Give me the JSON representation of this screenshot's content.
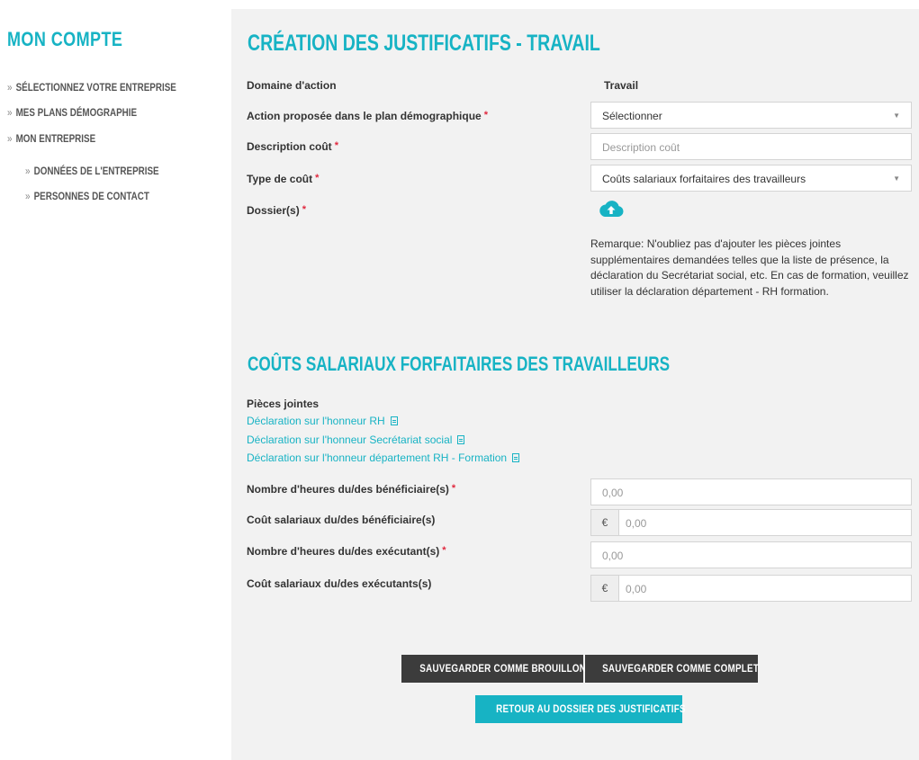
{
  "sidebar": {
    "title": "MON COMPTE",
    "items": [
      {
        "label": "SÉLECTIONNEZ VOTRE ENTREPRISE"
      },
      {
        "label": "MES PLANS DÉMOGRAPHIE"
      },
      {
        "label": "MON ENTREPRISE"
      },
      {
        "label": "DONNÉES DE L'ENTREPRISE"
      },
      {
        "label": "PERSONNES DE CONTACT"
      }
    ]
  },
  "form": {
    "title": "CRÉATION DES JUSTIFICATIFS - TRAVAIL",
    "domain_label": "Domaine d'action",
    "domain_value": "Travail",
    "action_label": "Action proposée dans le plan démographique",
    "action_value": "Sélectionner",
    "desc_label": "Description coût",
    "desc_placeholder": "Description coût",
    "type_label": "Type de coût",
    "type_value": "Coûts salariaux forfaitaires des travailleurs",
    "dossier_label": "Dossier(s)",
    "required_mark": "*",
    "remark": "Remarque: N'oubliez pas d'ajouter les pièces jointes supplémentaires demandées telles que la liste de présence, la déclaration du Secrétariat social, etc. En cas de formation, veuillez utiliser la déclaration département - RH formation."
  },
  "section": {
    "title": "COÛTS SALARIAUX FORFAITAIRES DES TRAVAILLEURS",
    "attachments_title": "Pièces jointes",
    "attachments": [
      {
        "label": "Déclaration sur l'honneur RH"
      },
      {
        "label": "Déclaration sur l'honneur Secrétariat social"
      },
      {
        "label": "Déclaration sur l'honneur département RH - Formation"
      }
    ],
    "hours_benef_label": "Nombre d'heures du/des bénéficiaire(s)",
    "hours_benef_value": "0,00",
    "cost_benef_label": "Coût salariaux du/des bénéficiaire(s)",
    "cost_benef_value": "0,00",
    "hours_exec_label": "Nombre d'heures du/des exécutant(s)",
    "hours_exec_value": "0,00",
    "cost_exec_label": "Coût salariaux du/des exécutants(s)",
    "cost_exec_value": "0,00",
    "currency": "€"
  },
  "buttons": {
    "draft": "SAUVEGARDER COMME BROUILLON",
    "complete": "SAUVEGARDER COMME COMPLET",
    "back": "RETOUR AU DOSSIER DES JUSTIFICATIFS"
  },
  "colors": {
    "accent": "#17b3c4",
    "dark_button": "#3c3c3c",
    "required": "#e0283e"
  }
}
